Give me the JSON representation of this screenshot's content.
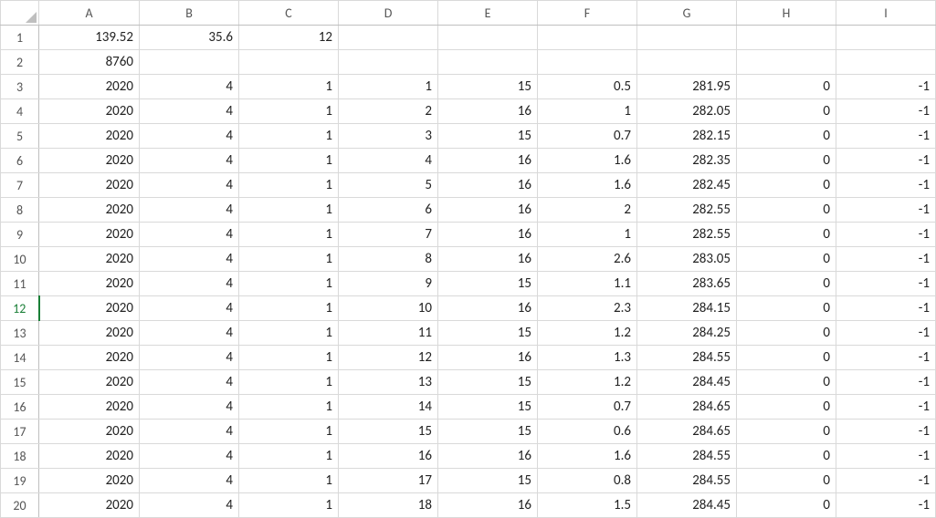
{
  "columns": [
    "A",
    "B",
    "C",
    "D",
    "E",
    "F",
    "G",
    "H",
    "I",
    ""
  ],
  "selected_row_header": "12",
  "rows": [
    {
      "n": "1",
      "c": [
        "139.52",
        "35.6",
        "12",
        "",
        "",
        "",
        "",
        "",
        "",
        ""
      ]
    },
    {
      "n": "2",
      "c": [
        "8760",
        "",
        "",
        "",
        "",
        "",
        "",
        "",
        "",
        ""
      ]
    },
    {
      "n": "3",
      "c": [
        "2020",
        "4",
        "1",
        "1",
        "15",
        "0.5",
        "281.95",
        "0",
        "-1",
        ""
      ]
    },
    {
      "n": "4",
      "c": [
        "2020",
        "4",
        "1",
        "2",
        "16",
        "1",
        "282.05",
        "0",
        "-1",
        ""
      ]
    },
    {
      "n": "5",
      "c": [
        "2020",
        "4",
        "1",
        "3",
        "15",
        "0.7",
        "282.15",
        "0",
        "-1",
        ""
      ]
    },
    {
      "n": "6",
      "c": [
        "2020",
        "4",
        "1",
        "4",
        "16",
        "1.6",
        "282.35",
        "0",
        "-1",
        ""
      ]
    },
    {
      "n": "7",
      "c": [
        "2020",
        "4",
        "1",
        "5",
        "16",
        "1.6",
        "282.45",
        "0",
        "-1",
        ""
      ]
    },
    {
      "n": "8",
      "c": [
        "2020",
        "4",
        "1",
        "6",
        "16",
        "2",
        "282.55",
        "0",
        "-1",
        ""
      ]
    },
    {
      "n": "9",
      "c": [
        "2020",
        "4",
        "1",
        "7",
        "16",
        "1",
        "282.55",
        "0",
        "-1",
        ""
      ]
    },
    {
      "n": "10",
      "c": [
        "2020",
        "4",
        "1",
        "8",
        "16",
        "2.6",
        "283.05",
        "0",
        "-1",
        ""
      ]
    },
    {
      "n": "11",
      "c": [
        "2020",
        "4",
        "1",
        "9",
        "15",
        "1.1",
        "283.65",
        "0",
        "-1",
        ""
      ]
    },
    {
      "n": "12",
      "c": [
        "2020",
        "4",
        "1",
        "10",
        "16",
        "2.3",
        "284.15",
        "0",
        "-1",
        ""
      ]
    },
    {
      "n": "13",
      "c": [
        "2020",
        "4",
        "1",
        "11",
        "15",
        "1.2",
        "284.25",
        "0",
        "-1",
        ""
      ]
    },
    {
      "n": "14",
      "c": [
        "2020",
        "4",
        "1",
        "12",
        "16",
        "1.3",
        "284.55",
        "0",
        "-1",
        ""
      ]
    },
    {
      "n": "15",
      "c": [
        "2020",
        "4",
        "1",
        "13",
        "15",
        "1.2",
        "284.45",
        "0",
        "-1",
        ""
      ]
    },
    {
      "n": "16",
      "c": [
        "2020",
        "4",
        "1",
        "14",
        "15",
        "0.7",
        "284.65",
        "0",
        "-1",
        ""
      ]
    },
    {
      "n": "17",
      "c": [
        "2020",
        "4",
        "1",
        "15",
        "15",
        "0.6",
        "284.65",
        "0",
        "-1",
        ""
      ]
    },
    {
      "n": "18",
      "c": [
        "2020",
        "4",
        "1",
        "16",
        "16",
        "1.6",
        "284.55",
        "0",
        "-1",
        ""
      ]
    },
    {
      "n": "19",
      "c": [
        "2020",
        "4",
        "1",
        "17",
        "15",
        "0.8",
        "284.55",
        "0",
        "-1",
        ""
      ]
    },
    {
      "n": "20",
      "c": [
        "2020",
        "4",
        "1",
        "18",
        "16",
        "1.5",
        "284.45",
        "0",
        "-1",
        ""
      ]
    }
  ]
}
